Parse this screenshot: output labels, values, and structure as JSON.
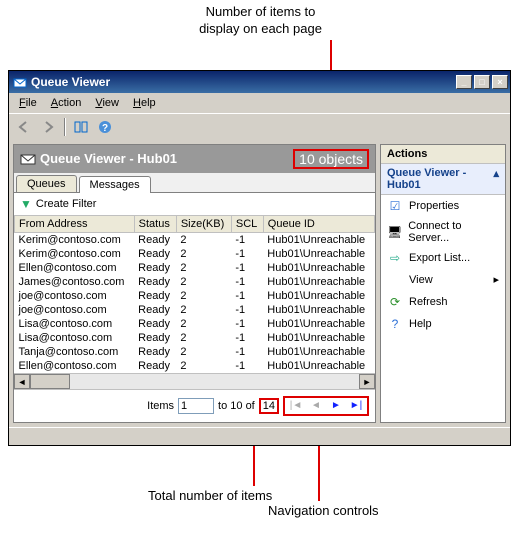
{
  "annotations": {
    "top": "Number of items to\ndisplay on each page",
    "bottom_left": "Total number of items",
    "bottom_right": "Navigation controls"
  },
  "window": {
    "title": "Queue Viewer"
  },
  "menu": {
    "file": "File",
    "action": "Action",
    "view": "View",
    "help": "Help"
  },
  "header": {
    "title": "Queue Viewer - Hub01",
    "objects": "10 objects"
  },
  "tabs": {
    "queues": "Queues",
    "messages": "Messages"
  },
  "filter": {
    "create": "Create Filter"
  },
  "columns": {
    "from": "From Address",
    "status": "Status",
    "size": "Size(KB)",
    "scl": "SCL",
    "queue": "Queue ID"
  },
  "rows": [
    {
      "from": "Kerim@contoso.com",
      "status": "Ready",
      "size": "2",
      "scl": "-1",
      "queue": "Hub01\\Unreachable"
    },
    {
      "from": "Kerim@contoso.com",
      "status": "Ready",
      "size": "2",
      "scl": "-1",
      "queue": "Hub01\\Unreachable"
    },
    {
      "from": "Ellen@contoso.com",
      "status": "Ready",
      "size": "2",
      "scl": "-1",
      "queue": "Hub01\\Unreachable"
    },
    {
      "from": "James@contoso.com",
      "status": "Ready",
      "size": "2",
      "scl": "-1",
      "queue": "Hub01\\Unreachable"
    },
    {
      "from": "joe@contoso.com",
      "status": "Ready",
      "size": "2",
      "scl": "-1",
      "queue": "Hub01\\Unreachable"
    },
    {
      "from": "joe@contoso.com",
      "status": "Ready",
      "size": "2",
      "scl": "-1",
      "queue": "Hub01\\Unreachable"
    },
    {
      "from": "Lisa@contoso.com",
      "status": "Ready",
      "size": "2",
      "scl": "-1",
      "queue": "Hub01\\Unreachable"
    },
    {
      "from": "Lisa@contoso.com",
      "status": "Ready",
      "size": "2",
      "scl": "-1",
      "queue": "Hub01\\Unreachable"
    },
    {
      "from": "Tanja@contoso.com",
      "status": "Ready",
      "size": "2",
      "scl": "-1",
      "queue": "Hub01\\Unreachable"
    },
    {
      "from": "Ellen@contoso.com",
      "status": "Ready",
      "size": "2",
      "scl": "-1",
      "queue": "Hub01\\Unreachable"
    }
  ],
  "pager": {
    "items_label": "Items",
    "page_value": "1",
    "to_label": "to 10 of",
    "total": "14"
  },
  "actions": {
    "header": "Actions",
    "subheader": "Queue Viewer - Hub01",
    "items": {
      "properties": "Properties",
      "connect": "Connect to Server...",
      "export": "Export List...",
      "view": "View",
      "refresh": "Refresh",
      "help": "Help"
    }
  }
}
